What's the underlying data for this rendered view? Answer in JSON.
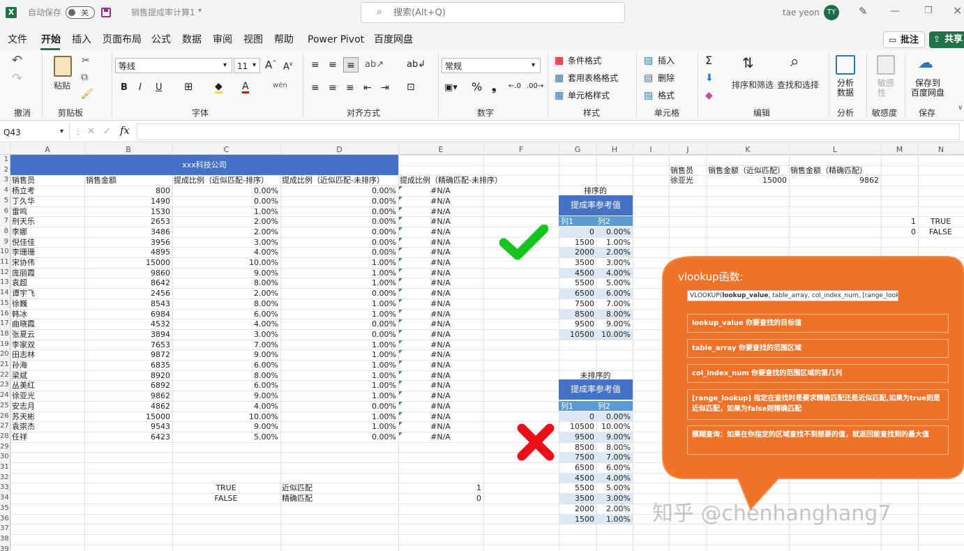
{
  "titlebar": {
    "autosave_label": "自动保存",
    "autosave_state": "关",
    "file_name": "销售提成率计算1",
    "search_placeholder": "搜索(Alt+Q)",
    "user_name": "tae yeon",
    "user_initials": "TY"
  },
  "menu": [
    "文件",
    "开始",
    "插入",
    "页面布局",
    "公式",
    "数据",
    "审阅",
    "视图",
    "帮助",
    "Power Pivot",
    "百度网盘"
  ],
  "menu_right": {
    "comments": "批注",
    "share": "共享"
  },
  "ribbon": {
    "undo_group": "撤消",
    "paste": "粘贴",
    "clipboard_group": "剪贴板",
    "font_name": "等线",
    "font_size": "11",
    "font_group": "字体",
    "align_group": "对齐方式",
    "number_format": "常规",
    "number_group": "数字",
    "cond_format": "条件格式",
    "table_format": "套用表格格式",
    "cell_style": "单元格样式",
    "style_group": "样式",
    "insert": "插入",
    "delete": "删除",
    "format": "格式",
    "cells_group": "单元格",
    "sort_filter": "排序和筛选",
    "find_select": "查找和选择",
    "edit_group": "编辑",
    "analyze": "分析\n数据",
    "analyze_group": "分析",
    "sensitivity": "敏感\n性",
    "sensitivity_group": "敏感度",
    "save_baidu": "保存到\n百度网盘",
    "save_group": "保存"
  },
  "formula_bar": {
    "name_box": "Q43",
    "formula": ""
  },
  "columns": [
    "A",
    "B",
    "C",
    "D",
    "E",
    "F",
    "G",
    "H",
    "I",
    "J",
    "K",
    "L",
    "M",
    "N"
  ],
  "rows": [
    "1",
    "2",
    "3",
    "4",
    "5",
    "6",
    "7",
    "8",
    "9",
    "10",
    "11",
    "12",
    "13",
    "14",
    "15",
    "16",
    "17",
    "18",
    "19",
    "20",
    "21",
    "22",
    "23",
    "24",
    "25",
    "26",
    "27",
    "28",
    "29",
    "30",
    "31",
    "32",
    "33",
    "34",
    "35",
    "36",
    "37",
    "38",
    "39"
  ],
  "sheet": {
    "company": "xxx科技公司",
    "headers": [
      "销售员",
      "销售金额",
      "提成比例（近似匹配-排序）",
      "提成比例（近似匹配-未排序）",
      "提成比例（精确匹配-未排序）"
    ],
    "data": [
      [
        "杨立考",
        "800",
        "0.00%",
        "0.00%",
        "#N/A"
      ],
      [
        "丁久华",
        "1490",
        "0.00%",
        "0.00%",
        "#N/A"
      ],
      [
        "雷鸣",
        "1530",
        "1.00%",
        "0.00%",
        "#N/A"
      ],
      [
        "刑天乐",
        "2653",
        "2.00%",
        "0.00%",
        "#N/A"
      ],
      [
        "李娜",
        "3486",
        "2.00%",
        "0.00%",
        "#N/A"
      ],
      [
        "倪佳佳",
        "3956",
        "3.00%",
        "0.00%",
        "#N/A"
      ],
      [
        "李珊珊",
        "4895",
        "4.00%",
        "0.00%",
        "#N/A"
      ],
      [
        "宋协伟",
        "15000",
        "10.00%",
        "1.00%",
        "#N/A"
      ],
      [
        "庞丽霞",
        "9860",
        "9.00%",
        "1.00%",
        "#N/A"
      ],
      [
        "袁超",
        "8642",
        "8.00%",
        "1.00%",
        "#N/A"
      ],
      [
        "谭宇飞",
        "2456",
        "2.00%",
        "0.00%",
        "#N/A"
      ],
      [
        "徐巍",
        "8543",
        "8.00%",
        "1.00%",
        "#N/A"
      ],
      [
        "韩冰",
        "6984",
        "6.00%",
        "1.00%",
        "#N/A"
      ],
      [
        "曲晓霞",
        "4532",
        "4.00%",
        "0.00%",
        "#N/A"
      ],
      [
        "张夏云",
        "3894",
        "3.00%",
        "0.00%",
        "#N/A"
      ],
      [
        "李家双",
        "7653",
        "7.00%",
        "1.00%",
        "#N/A"
      ],
      [
        "田志林",
        "9872",
        "9.00%",
        "1.00%",
        "#N/A"
      ],
      [
        "孙海",
        "6835",
        "6.00%",
        "1.00%",
        "#N/A"
      ],
      [
        "梁斌",
        "8920",
        "8.00%",
        "1.00%",
        "#N/A"
      ],
      [
        "丛美红",
        "6892",
        "6.00%",
        "1.00%",
        "#N/A"
      ],
      [
        "徐亚光",
        "9862",
        "9.00%",
        "1.00%",
        "#N/A"
      ],
      [
        "安志月",
        "4862",
        "4.00%",
        "0.00%",
        "#N/A"
      ],
      [
        "苏天彬",
        "15000",
        "10.00%",
        "1.00%",
        "#N/A"
      ],
      [
        "袁崇杰",
        "9543",
        "9.00%",
        "1.00%",
        "#N/A"
      ],
      [
        "任祥",
        "6423",
        "5.00%",
        "0.00%",
        "#N/A"
      ]
    ],
    "legend": [
      [
        "TRUE",
        "近似匹配",
        "1"
      ],
      [
        "FALSE",
        "精确匹配",
        "0"
      ]
    ],
    "sorted_title": "排序的",
    "unsorted_title": "未排序的",
    "ref_header": "提成率参考值",
    "ref_cols": [
      "列1",
      "列2"
    ],
    "sorted_ref": [
      [
        "0",
        "0.00%"
      ],
      [
        "1500",
        "1.00%"
      ],
      [
        "2000",
        "2.00%"
      ],
      [
        "3500",
        "3.00%"
      ],
      [
        "4500",
        "4.00%"
      ],
      [
        "5500",
        "5.00%"
      ],
      [
        "6500",
        "6.00%"
      ],
      [
        "7500",
        "7.00%"
      ],
      [
        "8500",
        "8.00%"
      ],
      [
        "9500",
        "9.00%"
      ],
      [
        "10500",
        "10.00%"
      ]
    ],
    "unsorted_ref": [
      [
        "0",
        "0.00%"
      ],
      [
        "10500",
        "10.00%"
      ],
      [
        "9500",
        "9.00%"
      ],
      [
        "8500",
        "8.00%"
      ],
      [
        "7500",
        "7.00%"
      ],
      [
        "6500",
        "6.00%"
      ],
      [
        "4500",
        "4.00%"
      ],
      [
        "5500",
        "5.00%"
      ],
      [
        "3500",
        "3.00%"
      ],
      [
        "2000",
        "2.00%"
      ],
      [
        "1500",
        "1.00%"
      ]
    ],
    "lookup_headers": [
      "销售员",
      "销售金额（近似匹配）",
      "销售金额（精确匹配）"
    ],
    "lookup_row": [
      "徐亚光",
      "15000",
      "9862"
    ],
    "side": [
      [
        "1",
        "TRUE"
      ],
      [
        "0",
        "FALSE"
      ]
    ]
  },
  "tooltip": {
    "title": "vlookup函数:",
    "syntax_fn": "VLOOKUP(",
    "syntax_bold": "lookup_value",
    "syntax_rest": ", table_array, col_index_num, [range_lookup])",
    "items": [
      "lookup_value 你要查找的目标值",
      "table_array 你要查找的范围区域",
      "col_index_num 你要查找的范围区域的第几列",
      "[range_lookup] 指定在查找时是要求精确匹配还是近似匹配,如果为true则是近似匹配，如果为false则精确匹配",
      "模糊查询：如果在你指定的区域查找不到想要的值，就返回能查找到的最大值"
    ]
  },
  "watermark": "知乎 @chenhanghang7",
  "colors": {
    "excel_green": "#217346",
    "header_blue": "#4472c4",
    "subheader_blue": "#5b9bd5",
    "band": "#dde8f4",
    "tooltip_orange": "#ee7228"
  }
}
